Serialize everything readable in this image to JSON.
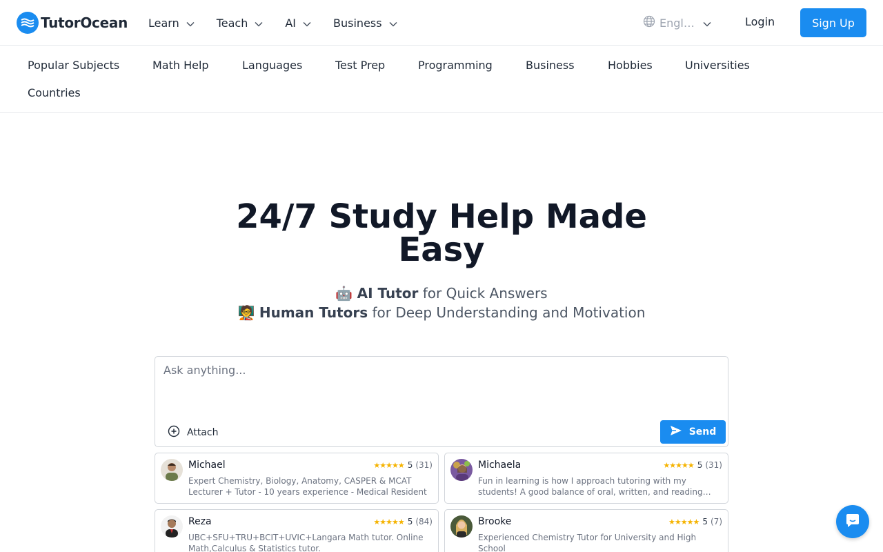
{
  "header": {
    "logo_text": "TutorOcean",
    "nav": [
      {
        "label": "Learn"
      },
      {
        "label": "Teach"
      },
      {
        "label": "AI"
      },
      {
        "label": "Business"
      }
    ],
    "language": "Engl…",
    "login": "Login",
    "signup": "Sign Up"
  },
  "subjects": [
    "Popular Subjects",
    "Math Help",
    "Languages",
    "Test Prep",
    "Programming",
    "Business",
    "Hobbies",
    "Universities",
    "Countries"
  ],
  "hero": {
    "title": "24/7 Study Help Made Easy",
    "line1_icon": "robot-emoji",
    "line1_bold": "AI Tutor",
    "line1_rest": " for Quick Answers",
    "line2_icon": "people-emoji",
    "line2_bold": "Human Tutors",
    "line2_rest": " for Deep Understanding and Motivation"
  },
  "ask": {
    "placeholder": "Ask anything...",
    "attach_label": "Attach",
    "send_label": "Send"
  },
  "tutors": [
    {
      "name": "Michael",
      "rating": "5",
      "count": "(31)",
      "desc": "Expert Chemistry, Biology, Anatomy, CASPER & MCAT Lecturer + Tutor - 10 years experience - Medical Resident"
    },
    {
      "name": "Michaela",
      "rating": "5",
      "count": "(31)",
      "desc": "Fun in learning is how I approach tutoring with my students! A good balance of oral, written, and reading…"
    },
    {
      "name": "Reza",
      "rating": "5",
      "count": "(84)",
      "desc": "UBC+SFU+TRU+BCIT+UVIC+Langara Math tutor. Online Math,Calculus & Statistics tutor."
    },
    {
      "name": "Brooke",
      "rating": "5",
      "count": "(7)",
      "desc": "Experienced Chemistry Tutor for University and High School"
    }
  ],
  "colors": {
    "accent": "#1a8cf0",
    "star": "#f5b301"
  }
}
